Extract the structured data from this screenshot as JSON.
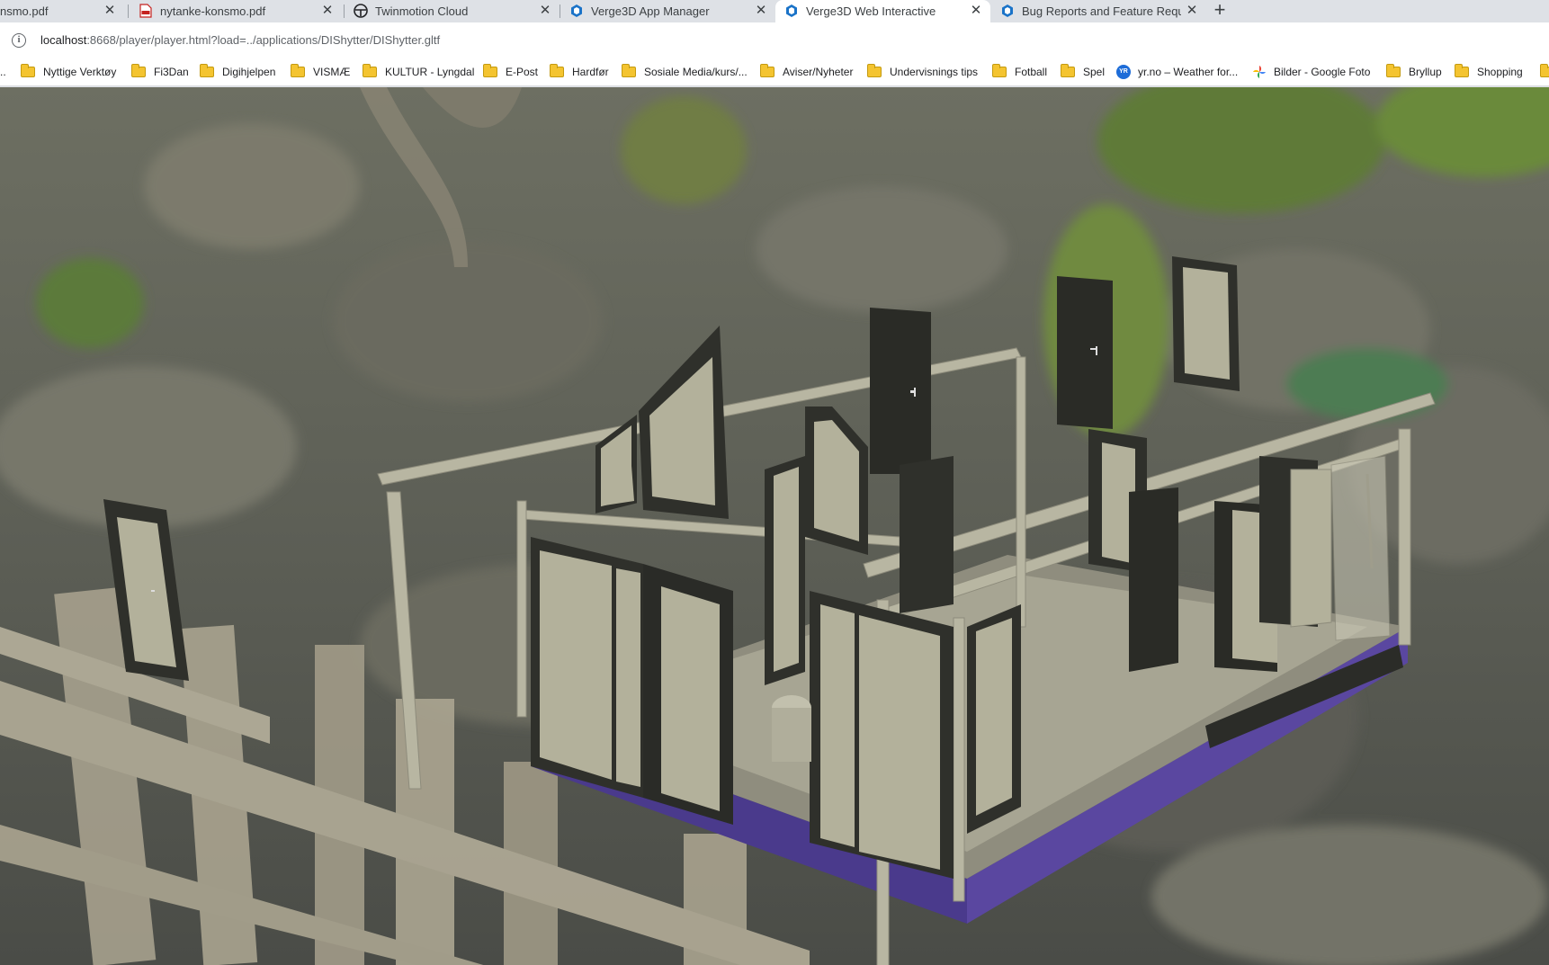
{
  "tabs": [
    {
      "title": "nsmo.pdf",
      "icon": "pdf-icon",
      "active": false
    },
    {
      "title": "nytanke-konsmo.pdf",
      "icon": "pdf-icon",
      "active": false
    },
    {
      "title": "Twinmotion Cloud",
      "icon": "twinmotion-icon",
      "active": false
    },
    {
      "title": "Verge3D App Manager",
      "icon": "verge3d-icon",
      "active": false
    },
    {
      "title": "Verge3D Web Interactive",
      "icon": "verge3d-icon",
      "active": true
    },
    {
      "title": "Bug Reports and Feature Reques",
      "icon": "verge3d-icon",
      "active": false
    }
  ],
  "new_tab_label": "+",
  "close_glyph": "✕",
  "address": {
    "host": "localhost",
    "path": ":8668/player/player.html?load=../applications/DIShytter/DIShytter.gltf"
  },
  "bookmarks": [
    {
      "label": "..",
      "icon": "none"
    },
    {
      "label": "Nyttige Verktøy",
      "icon": "folder-icon"
    },
    {
      "label": "Fi3Dan",
      "icon": "folder-icon"
    },
    {
      "label": "Digihjelpen",
      "icon": "folder-icon"
    },
    {
      "label": "VISMÆ",
      "icon": "folder-icon"
    },
    {
      "label": "KULTUR - Lyngdal",
      "icon": "folder-icon"
    },
    {
      "label": "E-Post",
      "icon": "folder-icon"
    },
    {
      "label": "Hardfør",
      "icon": "folder-icon"
    },
    {
      "label": "Sosiale Media/kurs/...",
      "icon": "folder-icon"
    },
    {
      "label": "Aviser/Nyheter",
      "icon": "folder-icon"
    },
    {
      "label": "Undervisnings tips",
      "icon": "folder-icon"
    },
    {
      "label": "Fotball",
      "icon": "folder-icon"
    },
    {
      "label": "Spel",
      "icon": "folder-icon"
    },
    {
      "label": "yr.no – Weather for...",
      "icon": "yr-icon"
    },
    {
      "label": "Bilder - Google Foto",
      "icon": "google-photos-icon"
    },
    {
      "label": "Bryllup",
      "icon": "folder-icon"
    },
    {
      "label": "Shopping",
      "icon": "folder-icon"
    }
  ],
  "yr_icon_text": "YR",
  "colors": {
    "floor_slab": "#4a3a8c",
    "frame_dark": "#2f302b",
    "panel_light": "#b3b19b",
    "beam": "#b8b6a2"
  }
}
